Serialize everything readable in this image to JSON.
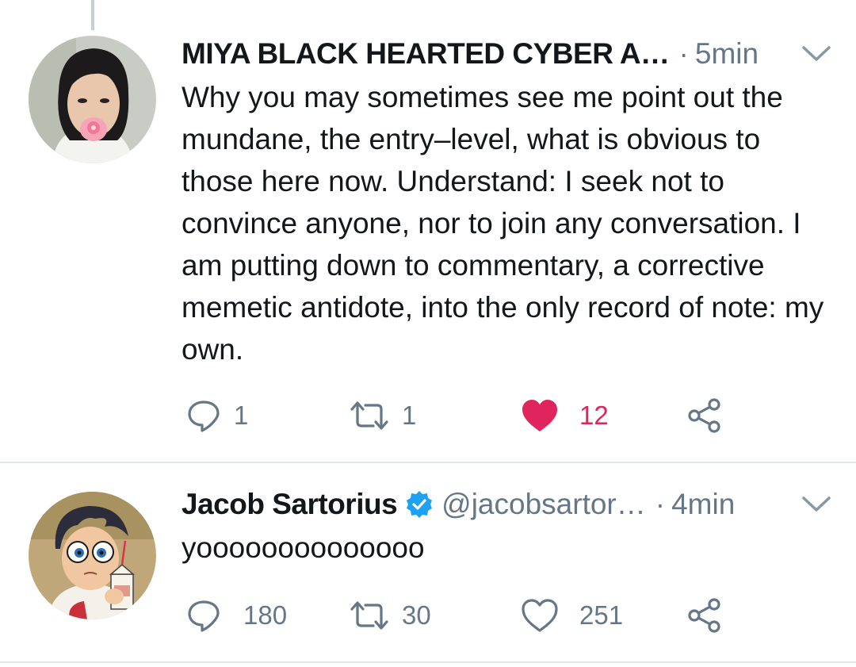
{
  "tweets": [
    {
      "name": "MIYA BLACK HEARTED CYBER A…",
      "dot": "·",
      "time": "5min",
      "text": "Why you may sometimes see me point out the mundane, the entry–level, what is obvious to those here now. Understand: I seek not to convince anyone, nor to join any conversation. I am putting down to commentary, a corrective memetic antidote, into the only record of note: my own.",
      "replies": "1",
      "retweets": "1",
      "likes": "12",
      "liked": true
    },
    {
      "name": "Jacob Sartorius",
      "verified": true,
      "handle": "@jacobsartor…",
      "dot": "·",
      "time": "4min",
      "text": "yoooooooooooooo",
      "replies": "180",
      "retweets": "30",
      "likes": "251",
      "liked": false
    }
  ],
  "colors": {
    "like_active": "#e0245e",
    "secondary_text": "#657786",
    "verified": "#1da1f2",
    "divider": "#e1e8ed"
  },
  "icons": [
    "reply-icon",
    "retweet-icon",
    "like-icon",
    "share-icon",
    "caret-down-icon",
    "verified-badge-icon"
  ]
}
